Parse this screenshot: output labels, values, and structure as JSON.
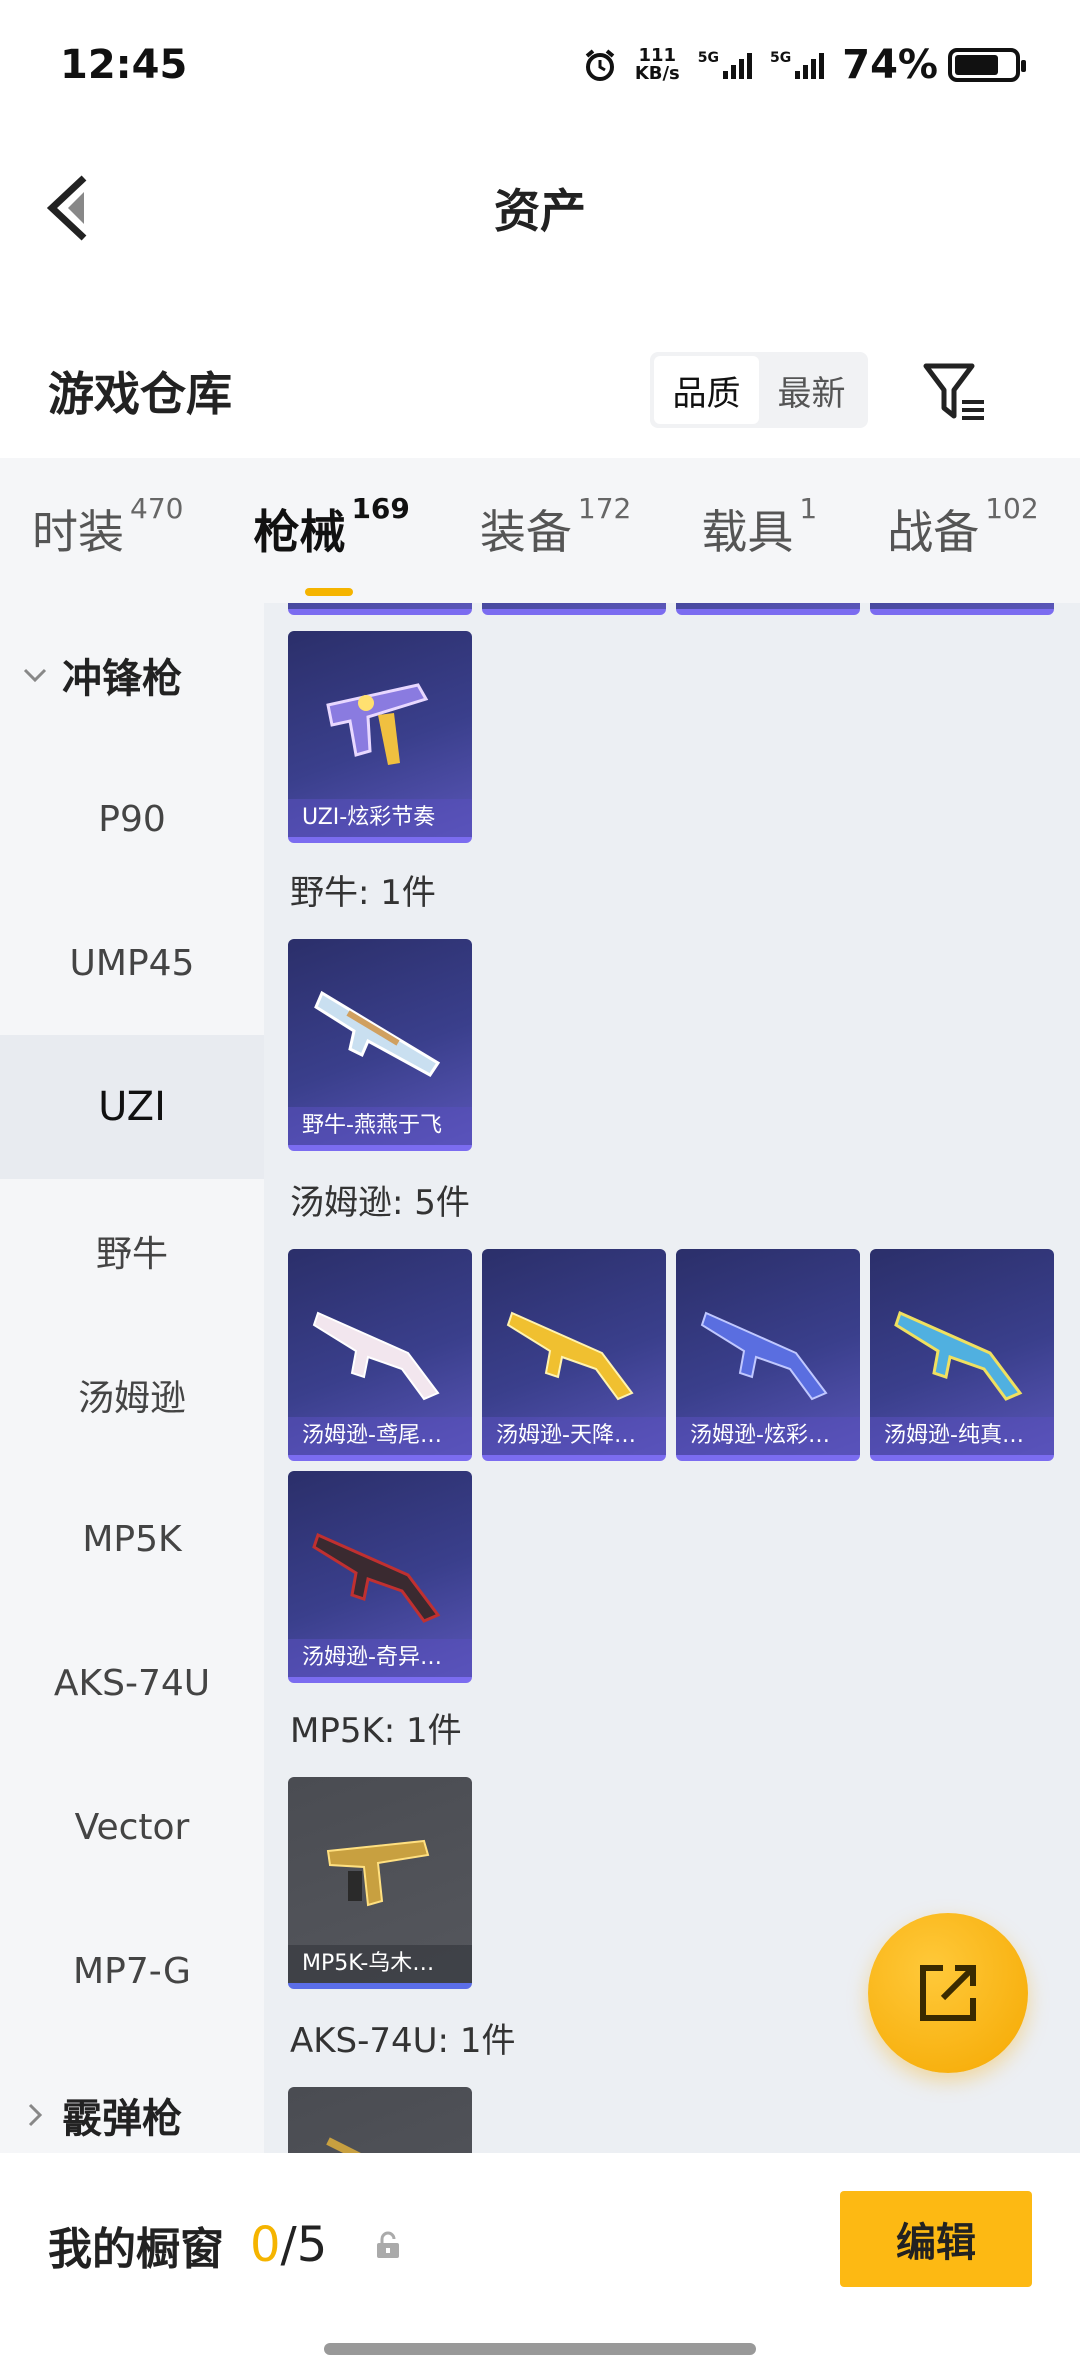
{
  "status_bar": {
    "time": "12:45",
    "net_speed_value": "111",
    "net_speed_unit": "KB/s",
    "signal_1": "5G",
    "signal_2": "5G",
    "battery_percent": "74%",
    "battery_level": 0.74,
    "icons": [
      "alarm-icon",
      "signal-icon",
      "battery-icon"
    ]
  },
  "header": {
    "title": "资产"
  },
  "warehouse": {
    "title": "游戏仓库",
    "sort_options": [
      "品质",
      "最新"
    ],
    "sort_selected": "品质"
  },
  "tabs": [
    {
      "label": "时装",
      "count": "470"
    },
    {
      "label": "枪械",
      "count": "169",
      "active": true
    },
    {
      "label": "装备",
      "count": "172"
    },
    {
      "label": "载具",
      "count": "1"
    },
    {
      "label": "战备",
      "count": "102"
    }
  ],
  "sidebar": {
    "group_expanded": "冲锋枪",
    "items": [
      "P90",
      "UMP45",
      "UZI",
      "野牛",
      "汤姆逊",
      "MP5K",
      "AKS-74U",
      "Vector",
      "MP7-G"
    ],
    "active_item": "UZI",
    "group_collapsed": "霰弹枪"
  },
  "content": {
    "uzi_items": [
      "UZI-炫彩节奏"
    ],
    "groups": [
      {
        "label": "野牛: 1件",
        "items": [
          "野牛-燕燕于飞"
        ]
      },
      {
        "label": "汤姆逊: 5件",
        "items": [
          "汤姆逊-鸢尾…",
          "汤姆逊-天降…",
          "汤姆逊-炫彩…",
          "汤姆逊-纯真…",
          "汤姆逊-奇异…"
        ]
      },
      {
        "label": "MP5K: 1件",
        "items": [
          "MP5K-乌木…"
        ]
      },
      {
        "label": "AKS-74U: 1件",
        "items": []
      }
    ]
  },
  "bottom": {
    "showcase_label": "我的橱窗",
    "showcase_count": "0",
    "showcase_total": "/5",
    "edit_label": "编辑"
  },
  "colors": {
    "accent": "#f5b400",
    "card_purple": "#3a3f8c",
    "card_grey": "#55575d"
  }
}
